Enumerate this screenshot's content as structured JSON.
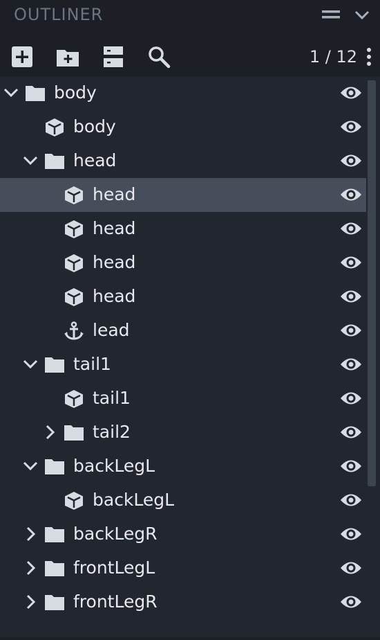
{
  "panel": {
    "title": "OUTLINER",
    "counter": "1 / 12"
  },
  "toolbar": {
    "buttons": [
      {
        "icon": "add-cube-icon"
      },
      {
        "icon": "add-folder-icon"
      },
      {
        "icon": "collapse-all-icon"
      },
      {
        "icon": "search-icon"
      }
    ]
  },
  "tree": {
    "rows": [
      {
        "label": "body",
        "type": "group",
        "expanded": true,
        "visible": true
      },
      {
        "label": "body",
        "type": "cube",
        "visible": true
      },
      {
        "label": "head",
        "type": "group",
        "expanded": true,
        "visible": true
      },
      {
        "label": "head",
        "type": "cube",
        "visible": true,
        "selected": true
      },
      {
        "label": "head",
        "type": "cube",
        "visible": true
      },
      {
        "label": "head",
        "type": "cube",
        "visible": true
      },
      {
        "label": "head",
        "type": "cube",
        "visible": true
      },
      {
        "label": "lead",
        "type": "locator",
        "visible": true
      },
      {
        "label": "tail1",
        "type": "group",
        "expanded": true,
        "visible": true
      },
      {
        "label": "tail1",
        "type": "cube",
        "visible": true
      },
      {
        "label": "tail2",
        "type": "group",
        "expanded": false,
        "visible": true
      },
      {
        "label": "backLegL",
        "type": "group",
        "expanded": true,
        "visible": true
      },
      {
        "label": "backLegL",
        "type": "cube",
        "visible": true
      },
      {
        "label": "backLegR",
        "type": "group",
        "expanded": false,
        "visible": true
      },
      {
        "label": "frontLegL",
        "type": "group",
        "expanded": false,
        "visible": true
      },
      {
        "label": "frontLegR",
        "type": "group",
        "expanded": false,
        "visible": true
      }
    ]
  },
  "colors": {
    "background": "#22262e",
    "header": "#1c1f26",
    "selected_row": "#474d5b",
    "text": "#e6e9ee",
    "icon": "#d7dbe2"
  }
}
